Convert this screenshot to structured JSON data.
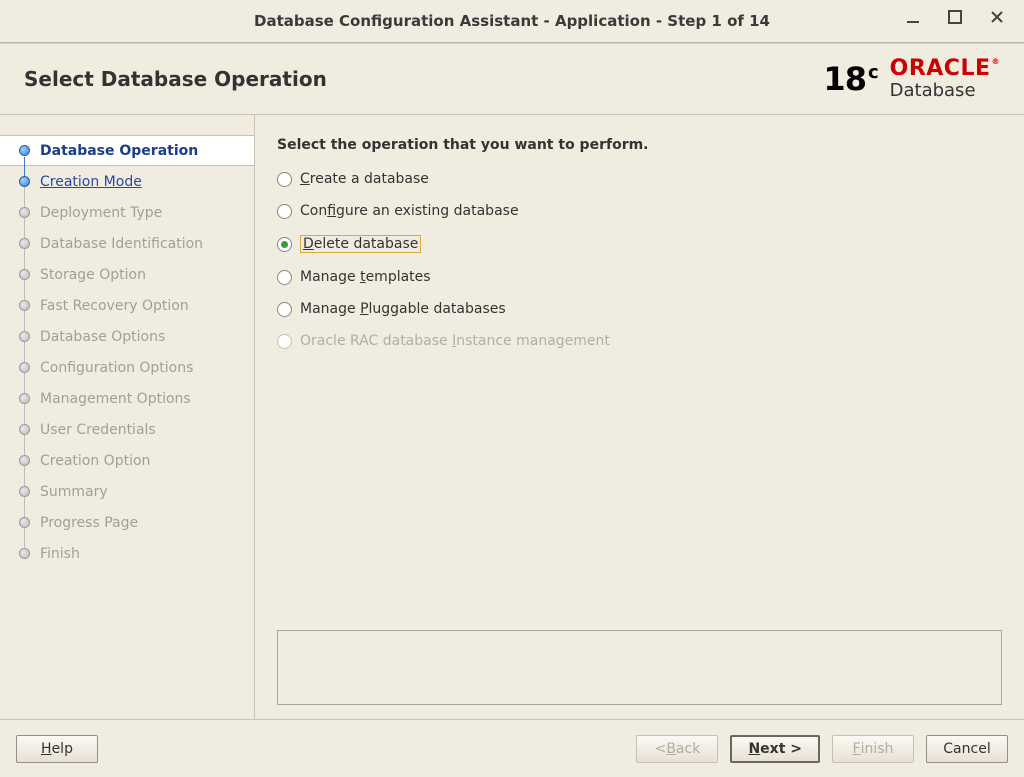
{
  "window": {
    "title": "Database Configuration Assistant - Application - Step 1 of 14"
  },
  "header": {
    "page_title": "Select Database Operation",
    "brand_version": "18",
    "brand_version_suffix": "c",
    "brand_name": "ORACLE",
    "brand_reg": "®",
    "brand_product": "Database"
  },
  "sidebar": {
    "steps": [
      {
        "label": "Database Operation"
      },
      {
        "label": "Creation Mode"
      },
      {
        "label": "Deployment Type"
      },
      {
        "label": "Database Identification"
      },
      {
        "label": "Storage Option"
      },
      {
        "label": "Fast Recovery Option"
      },
      {
        "label": "Database Options"
      },
      {
        "label": "Configuration Options"
      },
      {
        "label": "Management Options"
      },
      {
        "label": "User Credentials"
      },
      {
        "label": "Creation Option"
      },
      {
        "label": "Summary"
      },
      {
        "label": "Progress Page"
      },
      {
        "label": "Finish"
      }
    ]
  },
  "main": {
    "instruction": "Select the operation that you want to perform.",
    "options": [
      {
        "pre": "",
        "u": "C",
        "post": "reate a database",
        "selected": false,
        "disabled": false
      },
      {
        "pre": "Con",
        "u": "f",
        "post": "igure an existing database",
        "selected": false,
        "disabled": false
      },
      {
        "pre": "",
        "u": "D",
        "post": "elete database",
        "selected": true,
        "disabled": false
      },
      {
        "pre": "Manage ",
        "u": "t",
        "post": "emplates",
        "selected": false,
        "disabled": false
      },
      {
        "pre": "Manage ",
        "u": "P",
        "post": "luggable databases",
        "selected": false,
        "disabled": false
      },
      {
        "pre": "Oracle RAC database ",
        "u": "I",
        "post": "nstance management",
        "selected": false,
        "disabled": true
      }
    ]
  },
  "footer": {
    "help": {
      "pre": "",
      "u": "H",
      "post": "elp"
    },
    "back": {
      "pre": "< ",
      "u": "B",
      "post": "ack"
    },
    "next": {
      "pre": "",
      "u": "N",
      "post": "ext >"
    },
    "finish": {
      "pre": "",
      "u": "F",
      "post": "inish"
    },
    "cancel": {
      "pre": "Cancel",
      "u": "",
      "post": ""
    }
  }
}
